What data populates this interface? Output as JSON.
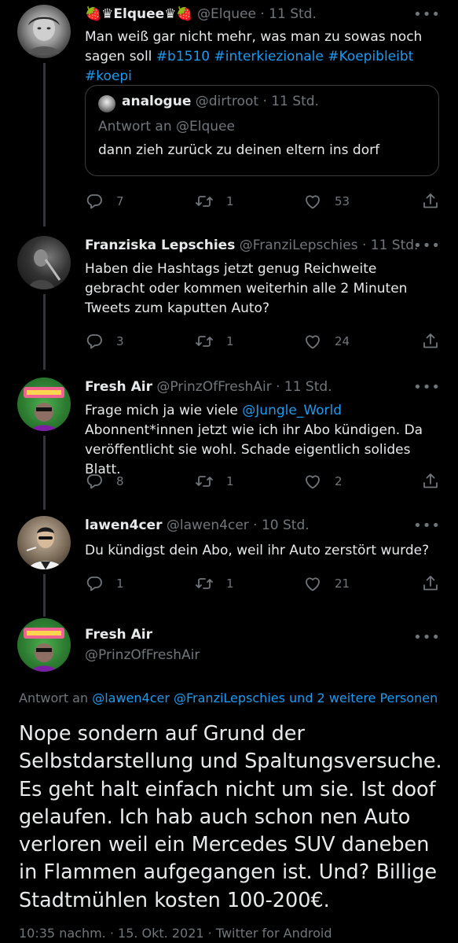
{
  "tweets": [
    {
      "name": "🍓♛Elquee♛🍓",
      "handle": "@Elquee",
      "time": "· 11 Std.",
      "more": "•••",
      "text_plain": "Man weiß gar nicht mehr, was man zu sowas noch sagen soll ",
      "hashtags": [
        "#b1510",
        "#interkiezionale",
        "#Koepibleibt",
        "#koepi"
      ],
      "quote": {
        "name": "analogue",
        "handle": "@dirtroot",
        "time": "· 11 Std.",
        "reply_to": "Antwort an @Elquee",
        "text": "dann zieh zurück zu deinen eltern ins dorf"
      },
      "replies": "7",
      "retweets": "1",
      "likes": "53"
    },
    {
      "name": "Franziska Lepschies",
      "handle": "@FranziLepschies",
      "time": "· 11 Std.",
      "more": "•••",
      "text": "Haben die Hashtags jetzt genug Reichweite gebracht oder kommen weiterhin alle 2 Minuten Tweets zum kaputten Auto?",
      "replies": "3",
      "retweets": "1",
      "likes": "24"
    },
    {
      "name": "Fresh Air",
      "handle": "@PrinzOfFreshAir",
      "time": "· 11 Std.",
      "more": "•••",
      "text_before": "Frage mich ja wie viele ",
      "mention": "@Jungle_World",
      "text_after": " Abonnent*innen jetzt wie ich ihr Abo kündigen. Da veröffentlicht sie wohl. Schade eigentlich solides Blatt.",
      "replies": "8",
      "retweets": "1",
      "likes": "2"
    },
    {
      "name": "lawen4cer",
      "handle": "@lawen4cer",
      "time": "· 10 Std.",
      "more": "•••",
      "text": "Du kündigst dein Abo, weil ihr Auto zerstört wurde?",
      "replies": "1",
      "retweets": "1",
      "likes": "21"
    }
  ],
  "main": {
    "name": "Fresh Air",
    "handle": "@PrinzOfFreshAir",
    "more": "•••",
    "replying_label": "Antwort an ",
    "replying_to": "@lawen4cer @FranziLepschies und 2 weitere Personen",
    "text": "Nope sondern auf Grund der Selbstdarstellung und Spaltungsversuche. Es geht halt einfach nicht um sie. Ist doof gelaufen. Ich hab auch schon nen Auto verloren weil ein Mercedes SUV daneben in Flammen aufgegangen ist. Und? Billige Stadtmühlen kosten 100-200€.",
    "meta": "10:35 nachm. · 15. Okt. 2021 · Twitter for Android"
  },
  "colors": {
    "background": "#000000",
    "text": "#e7e9ea",
    "muted": "#71767b",
    "link": "#1d9bf0",
    "thread_line": "#333639"
  },
  "icons": [
    "reply-icon",
    "retweet-icon",
    "like-icon",
    "share-icon",
    "more-icon"
  ]
}
